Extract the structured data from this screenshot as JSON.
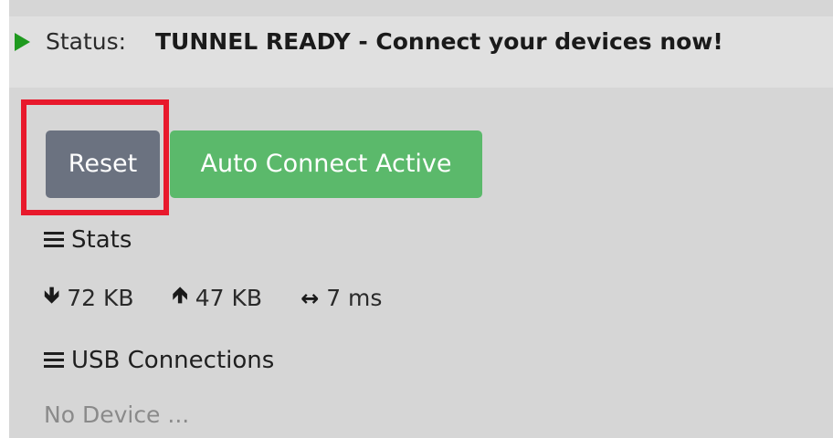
{
  "status": {
    "label": "Status:",
    "value": "TUNNEL READY - Connect your devices now!",
    "icon": "play-icon",
    "icon_color": "#1f9a1f"
  },
  "buttons": {
    "reset_label": "Reset",
    "reset_color": "#6b7280",
    "auto_connect_label": "Auto Connect Active",
    "auto_connect_color": "#5bb96b"
  },
  "highlight_color": "#e8192c",
  "stats": {
    "title": "Stats",
    "download": {
      "icon": "arrow-down-icon",
      "value": "72 KB"
    },
    "upload": {
      "icon": "arrow-up-icon",
      "value": "47 KB"
    },
    "latency": {
      "icon": "arrow-left-right-icon",
      "value": "7 ms"
    }
  },
  "usb": {
    "title": "USB Connections",
    "empty_text": "No Device ..."
  }
}
